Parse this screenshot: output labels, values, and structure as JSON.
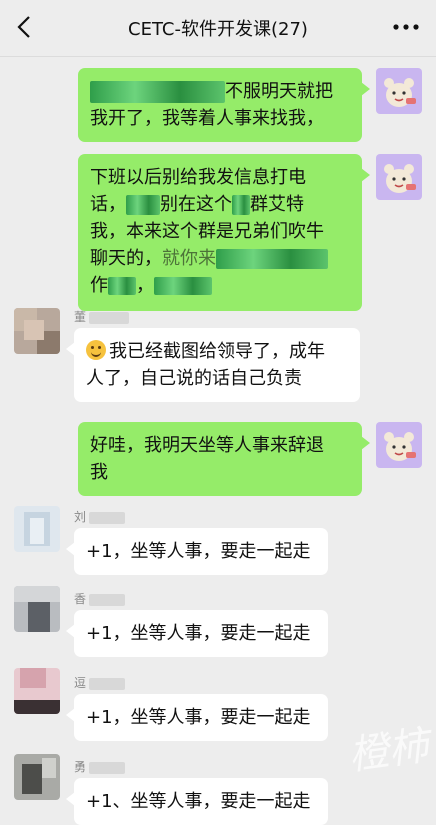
{
  "header": {
    "title": "CETC-软件开发课(27)",
    "back_icon": "chevron-left-icon",
    "more_icon": "more-horizontal-icon"
  },
  "messages": [
    {
      "side": "me",
      "line1_end": "不服明天就把",
      "line2": "我开了，我等着人事来找我，",
      "avatar": "cartoon-avatar"
    },
    {
      "side": "me",
      "line1": "下班以后别给我发信息打电",
      "line2_a": "话，",
      "line2_b": "别在这个",
      "line2_c": "群艾特",
      "line3_a": "我，本来这个群是兄弟们吹牛",
      "line4_a": "聊天的，",
      "line4_b": "就你来",
      "line5_a": "作",
      "line5_b": "，",
      "avatar": "cartoon-avatar"
    },
    {
      "side": "other",
      "sender": "董",
      "text_line1": "我已经截图给领导了，成年",
      "text_line2": "人了，自己说的话自己负责",
      "emoji": "smile-emoji"
    },
    {
      "side": "me",
      "line1": "好哇，我明天坐等人事来辞退",
      "line2": "我",
      "avatar": "cartoon-avatar"
    },
    {
      "side": "other",
      "sender": "刘",
      "text": "+1，坐等人事，要走一起走"
    },
    {
      "side": "other",
      "sender": "香",
      "text": "+1，坐等人事，要走一起走"
    },
    {
      "side": "other",
      "sender": "逗",
      "text": "+1，坐等人事，要走一起走"
    },
    {
      "side": "other",
      "sender": "勇",
      "text": "+1、坐等人事，要走一起走"
    }
  ],
  "watermark": "橙柿"
}
